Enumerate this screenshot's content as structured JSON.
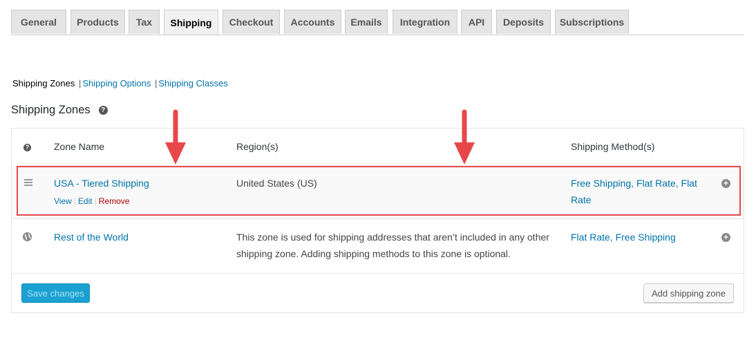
{
  "tabs": [
    {
      "label": "General"
    },
    {
      "label": "Products"
    },
    {
      "label": "Tax"
    },
    {
      "label": "Shipping",
      "active": true
    },
    {
      "label": "Checkout"
    },
    {
      "label": "Accounts"
    },
    {
      "label": "Emails"
    },
    {
      "label": "Integration"
    },
    {
      "label": "API"
    },
    {
      "label": "Deposits"
    },
    {
      "label": "Subscriptions"
    }
  ],
  "subnav": {
    "current": "Shipping Zones",
    "separator": "|",
    "options": "Shipping Options",
    "classes": "Shipping Classes"
  },
  "heading": {
    "title": "Shipping Zones",
    "help": "?"
  },
  "table": {
    "headers": {
      "help": "?",
      "zone_name": "Zone Name",
      "regions": "Region(s)",
      "methods": "Shipping Method(s)"
    },
    "rows": [
      {
        "name": "USA - Tiered Shipping",
        "region": "United States (US)",
        "methods": "Free Shipping, Flat Rate, Flat Rate",
        "actions": {
          "view": "View",
          "edit": "Edit",
          "remove": "Remove",
          "sep": "|"
        },
        "add": "+"
      },
      {
        "name": "Rest of the World",
        "region": "This zone is used for shipping addresses that aren’t included in any other shipping zone. Adding shipping methods to this zone is optional.",
        "methods": "Flat Rate, Free Shipping",
        "add": "+"
      }
    ]
  },
  "buttons": {
    "save": "Save changes",
    "add_zone": "Add shipping zone"
  },
  "colors": {
    "accent": "#0073aa",
    "highlight": "#e8474a",
    "primary_button": "#1ba1d1",
    "remove": "#aa0000"
  }
}
